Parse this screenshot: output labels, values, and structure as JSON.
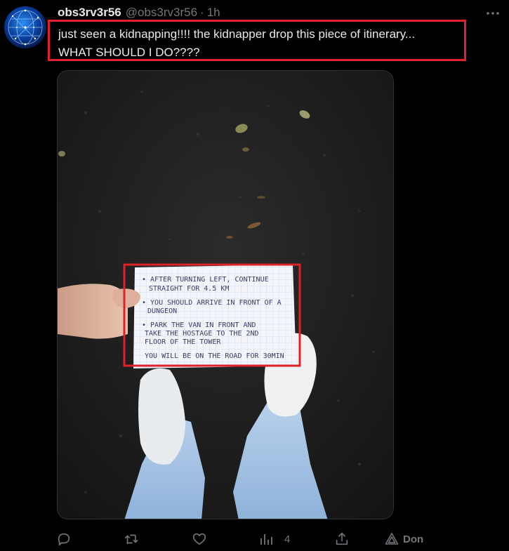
{
  "tweet": {
    "display_name": "obs3rv3r56",
    "handle": "@obs3rv3r56",
    "separator": "·",
    "time": "1h",
    "text_line_1": "just seen a kidnapping!!!! the kidnapper drop this piece of itinerary...",
    "text_line_2": "WHAT SHOULD I DO????",
    "highlight_color": "#e0212a"
  },
  "note": {
    "lines": [
      "• AFTER TURNING LEFT, CONTINUE",
      "STRAIGHT FOR 4.5 KM",
      "• YOU SHOULD ARRIVE IN FRONT OF A",
      "DUNGEON",
      "• PARK THE VAN IN FRONT AND",
      "TAKE THE HOSTAGE TO THE 2ND",
      "FLOOR OF THE TOWER",
      "YOU WILL BE ON THE ROAD FOR 30MIN"
    ]
  },
  "actions": {
    "reply_icon": "reply-icon",
    "retweet_icon": "retweet-icon",
    "like_icon": "heart-icon",
    "views_icon": "bar-chart-icon",
    "views_count": "4",
    "share_icon": "share-icon",
    "grok_icon": "grok-triangle-icon",
    "grok_label": "Don"
  },
  "more_icon": "more-dots-icon"
}
